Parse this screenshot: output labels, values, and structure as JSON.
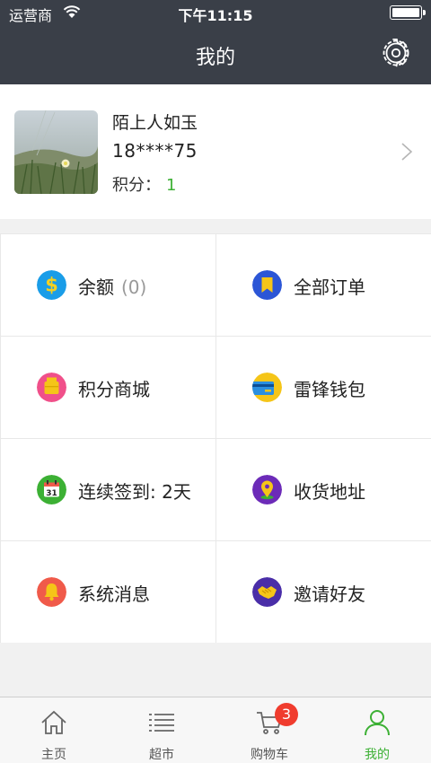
{
  "status_bar": {
    "carrier": "运营商",
    "time": "下午11:15"
  },
  "nav": {
    "title": "我的"
  },
  "profile": {
    "name": "陌上人如玉",
    "phone": "18****75",
    "points_label": "积分：",
    "points_value": "1"
  },
  "menu": [
    {
      "label": "余额",
      "extra": "(0)",
      "icon": "dollar-icon",
      "color": "#1a9de8"
    },
    {
      "label": "全部订单",
      "icon": "bookmark-icon",
      "color": "#2c56d6"
    },
    {
      "label": "积分商城",
      "icon": "gift-icon",
      "color": "#f0508a"
    },
    {
      "label": "雷锋钱包",
      "icon": "card-icon",
      "color": "#f5c518"
    },
    {
      "label": "连续签到: 2天",
      "icon": "calendar-icon",
      "color": "#3cb034"
    },
    {
      "label": "收货地址",
      "icon": "location-icon",
      "color": "#6c2bb8"
    },
    {
      "label": "系统消息",
      "icon": "bell-icon",
      "color": "#f05a4a"
    },
    {
      "label": "邀请好友",
      "icon": "handshake-icon",
      "color": "#4a2ea8"
    }
  ],
  "tabs": [
    {
      "label": "主页",
      "icon": "home-icon"
    },
    {
      "label": "超市",
      "icon": "list-icon"
    },
    {
      "label": "购物车",
      "icon": "cart-icon",
      "badge": "3"
    },
    {
      "label": "我的",
      "icon": "user-icon"
    }
  ],
  "colors": {
    "header": "#3a3f48",
    "accent_green": "#3cb034",
    "badge_red": "#f03c2e"
  }
}
